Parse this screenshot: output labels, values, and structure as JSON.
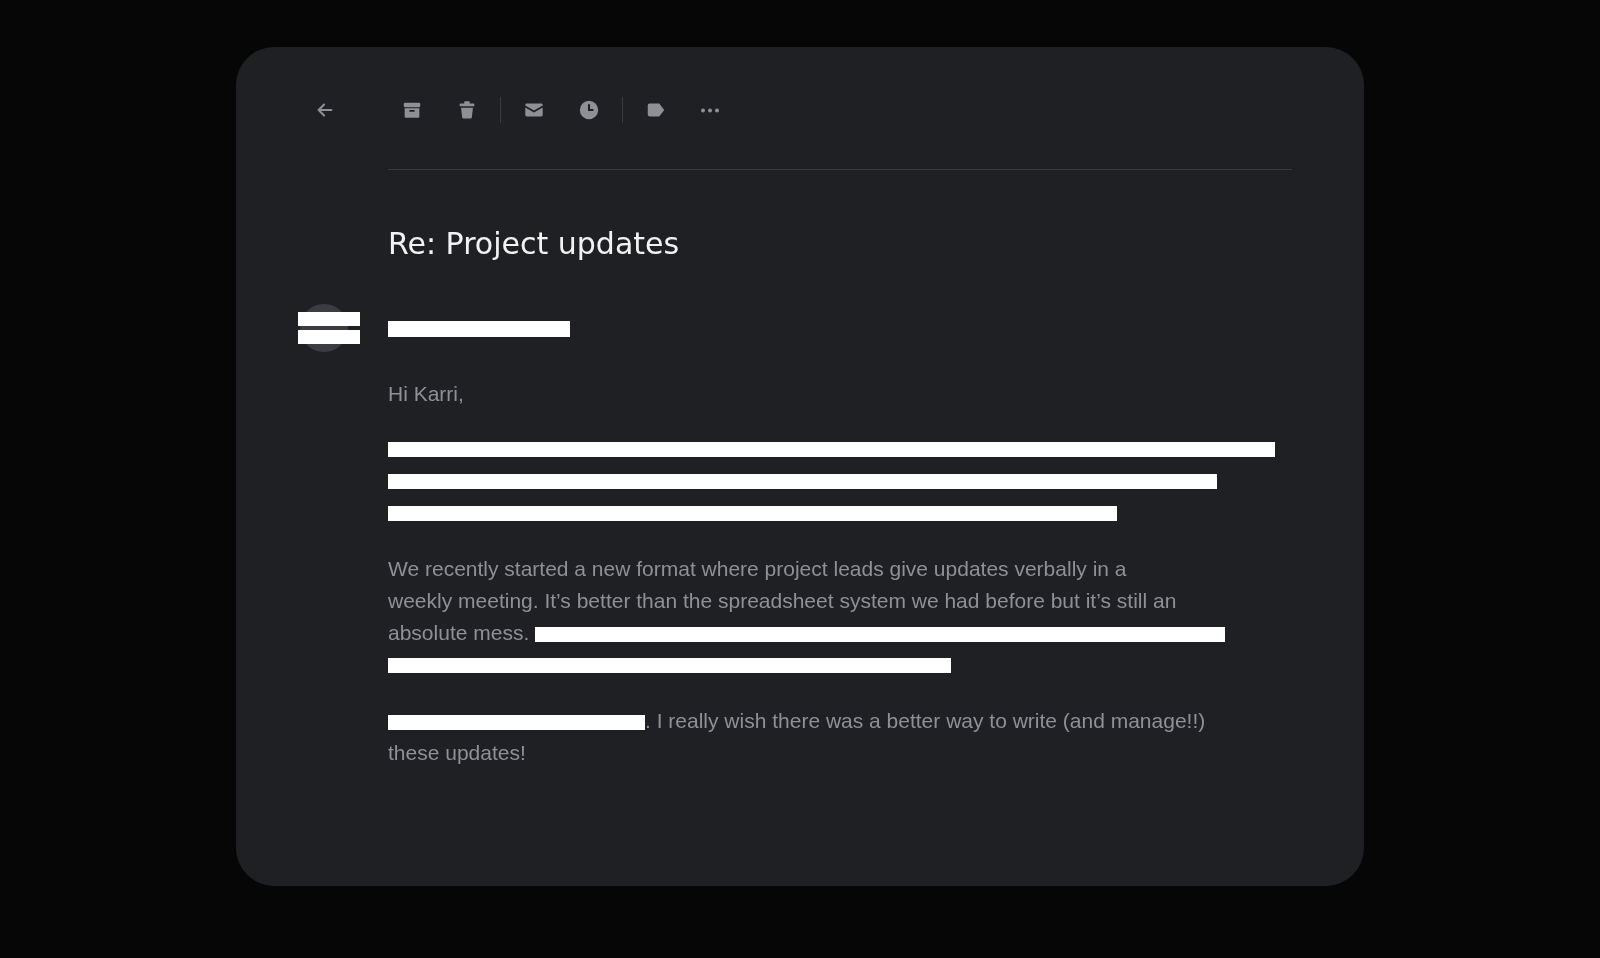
{
  "toolbar": {
    "groups": [
      [
        {
          "kind": "back"
        }
      ],
      [
        {
          "kind": "archive"
        },
        {
          "kind": "trash"
        }
      ],
      [
        {
          "kind": "mail"
        },
        {
          "kind": "clock"
        }
      ],
      [
        {
          "kind": "tag"
        },
        {
          "kind": "more"
        }
      ]
    ]
  },
  "subject": "Re: Project updates",
  "sender": {
    "avatar_redacted": true,
    "address_redacted": true
  },
  "greeting": "Hi Karri,",
  "paragraphs": [
    {
      "segments": [
        {
          "kind": "redaction"
        },
        {
          "kind": "redaction"
        },
        {
          "kind": "redaction"
        }
      ]
    },
    {
      "segments": [
        {
          "kind": "line",
          "text": "We recently started a new format where project leads give updates verbally in a"
        },
        {
          "kind": "line",
          "text": "weekly meeting. It’s better than the spreadsheet system we had before but it’s still an"
        },
        {
          "kind": "text",
          "text": "absolute mess. "
        },
        {
          "kind": "redaction"
        },
        {
          "kind": "redaction"
        }
      ]
    },
    {
      "segments": [
        {
          "kind": "redaction"
        },
        {
          "kind": "text",
          "text": ". I really wish there was a better way to write (and manage!!)"
        },
        {
          "kind": "line",
          "text": "these updates!"
        }
      ]
    }
  ]
}
